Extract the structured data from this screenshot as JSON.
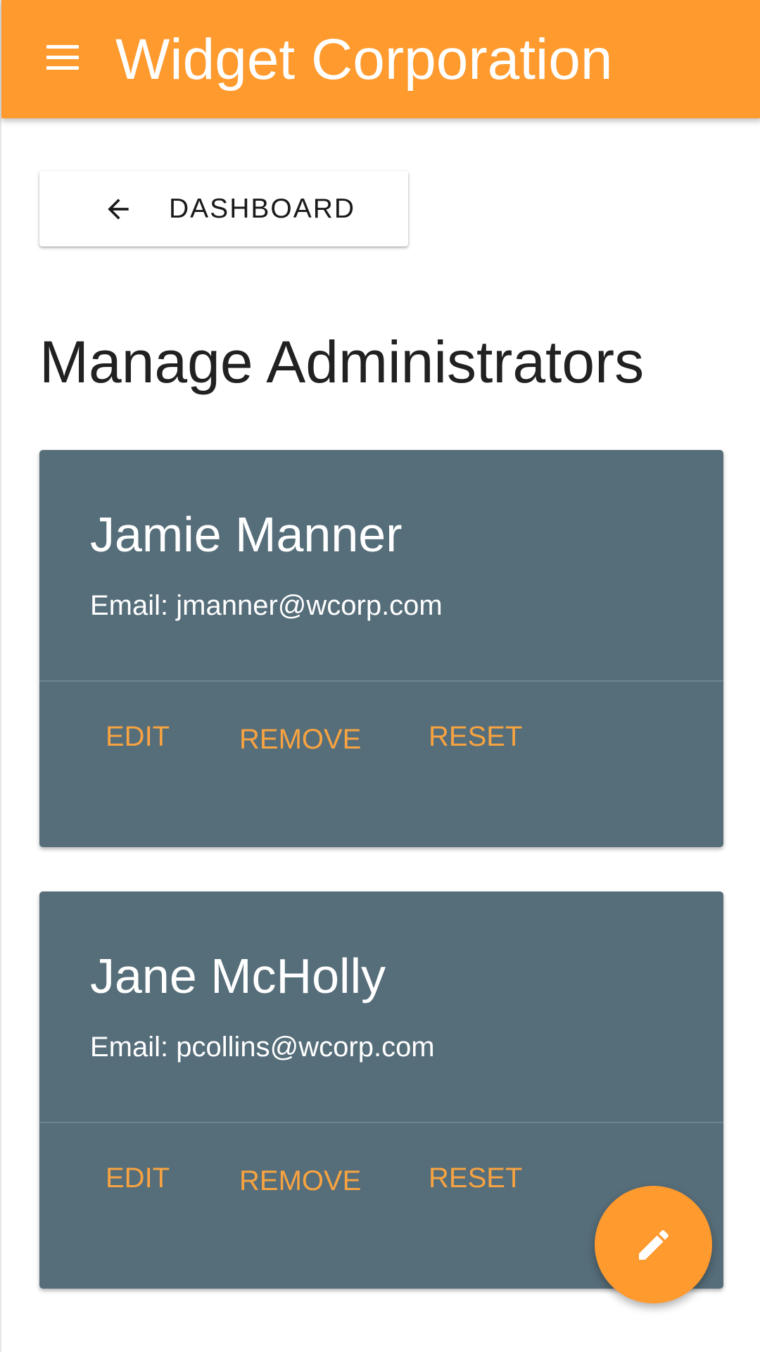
{
  "app_bar": {
    "title": "Widget Corporation",
    "menu_icon": "hamburger-menu-icon",
    "color": "#FF9A2E"
  },
  "back_button": {
    "icon": "arrow-left-icon",
    "label": "DASHBOARD"
  },
  "page": {
    "title": "Manage Administrators"
  },
  "admins": [
    {
      "name": "Jamie Manner",
      "email": "Email: jmanner@wcorp.com",
      "actions": {
        "edit": "EDIT",
        "remove": "REMOVE",
        "reset": "RESET"
      }
    },
    {
      "name": "Jane McHolly",
      "email": "Email: pcollins@wcorp.com",
      "actions": {
        "edit": "EDIT",
        "remove": "REMOVE",
        "reset": "RESET"
      }
    }
  ],
  "fab": {
    "icon": "pencil-icon"
  },
  "colors": {
    "accent": "#FF9A2E",
    "card_background": "#566E7A",
    "action_text": "#F8A340"
  }
}
